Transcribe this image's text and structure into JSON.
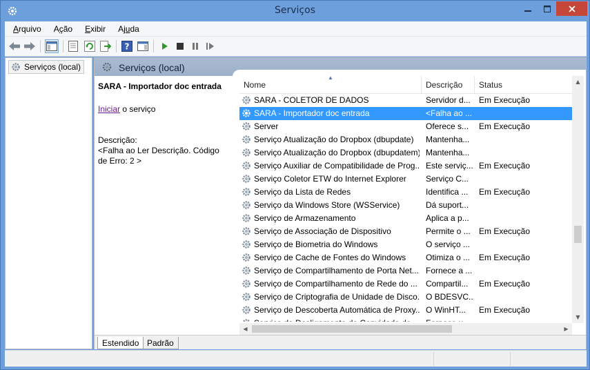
{
  "window": {
    "title": "Serviços"
  },
  "menu": [
    {
      "pre": "",
      "u": "A",
      "post": "rquivo"
    },
    {
      "pre": "A",
      "u": "ç",
      "post": "ão"
    },
    {
      "pre": "",
      "u": "E",
      "post": "xibir"
    },
    {
      "pre": "Aj",
      "u": "u",
      "post": "da"
    }
  ],
  "toolbar": {
    "icons": [
      "back-icon",
      "forward-icon",
      "show-hide-console-tree-icon",
      "properties-icon",
      "refresh-icon",
      "export-list-icon",
      "help-icon",
      "show-action-pane-icon",
      "start-service-icon",
      "stop-service-icon",
      "pause-service-icon",
      "restart-service-icon"
    ]
  },
  "tree": {
    "root_label": "Serviços (local)"
  },
  "header": {
    "title": "Serviços (local)"
  },
  "details": {
    "service_name": "SARA - Importador doc entrada",
    "start_link": "Iniciar",
    "start_suffix": " o serviço",
    "description_label": "Descrição:",
    "description_text": "<Falha ao Ler Descrição. Código de Erro: 2 >"
  },
  "columns": {
    "name": "Nome",
    "description": "Descrição",
    "status": "Status"
  },
  "rows": [
    {
      "name": "SARA - COLETOR DE DADOS",
      "desc": "Servidor d...",
      "status": "Em Execução",
      "selected": false
    },
    {
      "name": "SARA - Importador doc entrada",
      "desc": "<Falha ao ...",
      "status": "",
      "selected": true
    },
    {
      "name": "Server",
      "desc": "Oferece s...",
      "status": "Em Execução",
      "selected": false
    },
    {
      "name": "Serviço Atualização do Dropbox (dbupdate)",
      "desc": "Mantenha...",
      "status": "",
      "selected": false
    },
    {
      "name": "Serviço Atualização do Dropbox (dbupdatem)",
      "desc": "Mantenha...",
      "status": "",
      "selected": false
    },
    {
      "name": "Serviço Auxiliar de Compatibilidade de Prog...",
      "desc": "Este serviç...",
      "status": "Em Execução",
      "selected": false
    },
    {
      "name": "Serviço Coletor ETW do Internet Explorer",
      "desc": "Serviço C...",
      "status": "",
      "selected": false
    },
    {
      "name": "Serviço da Lista de Redes",
      "desc": "Identifica ...",
      "status": "Em Execução",
      "selected": false
    },
    {
      "name": "Serviço da Windows Store (WSService)",
      "desc": "Dá suport...",
      "status": "",
      "selected": false
    },
    {
      "name": "Serviço de Armazenamento",
      "desc": "Aplica a p...",
      "status": "",
      "selected": false
    },
    {
      "name": "Serviço de Associação de Dispositivo",
      "desc": "Permite o ...",
      "status": "Em Execução",
      "selected": false
    },
    {
      "name": "Serviço de Biometria do Windows",
      "desc": "O serviço ...",
      "status": "",
      "selected": false
    },
    {
      "name": "Serviço de Cache de Fontes do Windows",
      "desc": "Otimiza o ...",
      "status": "Em Execução",
      "selected": false
    },
    {
      "name": "Serviço de Compartilhamento de Porta Net....",
      "desc": "Fornece a ...",
      "status": "",
      "selected": false
    },
    {
      "name": "Serviço de Compartilhamento de Rede do ...",
      "desc": "Compartil...",
      "status": "Em Execução",
      "selected": false
    },
    {
      "name": "Serviço de Criptografia de Unidade de Disco...",
      "desc": "O BDESVC...",
      "status": "",
      "selected": false
    },
    {
      "name": "Serviço de Descoberta Automática de Proxy...",
      "desc": "O WinHT...",
      "status": "Em Execução",
      "selected": false
    },
    {
      "name": "Serviço de Desligamento de Convidado de ...",
      "desc": "Fornece u...",
      "status": "",
      "selected": false
    }
  ],
  "tabs": {
    "extended": "Estendido",
    "standard": "Padrão"
  },
  "colors": {
    "selection": "#3399ff",
    "titlebar": "#6d9fdc",
    "close": "#c7463a"
  }
}
